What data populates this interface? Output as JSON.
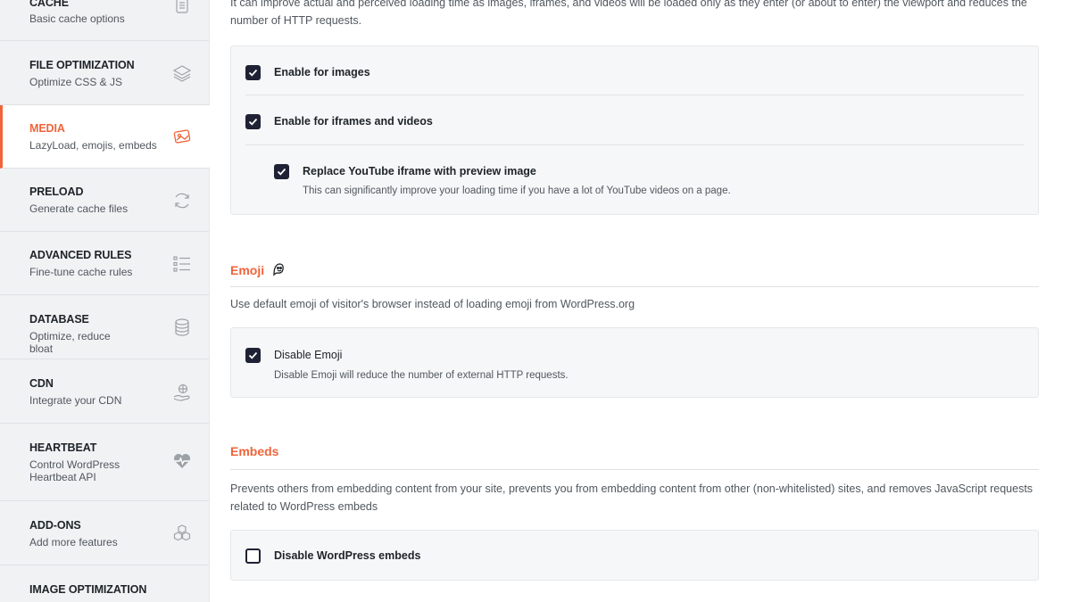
{
  "sidebar": {
    "items": [
      {
        "title": "CACHE",
        "desc": "Basic cache options",
        "icon": "document-icon"
      },
      {
        "title": "FILE OPTIMIZATION",
        "desc": "Optimize CSS & JS",
        "icon": "layers-icon"
      },
      {
        "title": "MEDIA",
        "desc": "LazyLoad, emojis, embeds",
        "icon": "media-icon",
        "active": true
      },
      {
        "title": "PRELOAD",
        "desc": "Generate cache files",
        "icon": "refresh-icon"
      },
      {
        "title": "ADVANCED RULES",
        "desc": "Fine-tune cache rules",
        "icon": "list-icon"
      },
      {
        "title": "DATABASE",
        "desc": "Optimize, reduce bloat",
        "icon": "database-icon"
      },
      {
        "title": "CDN",
        "desc": "Integrate your CDN",
        "icon": "cdn-hand-icon"
      },
      {
        "title": "HEARTBEAT",
        "desc": "Control WordPress Heartbeat API",
        "icon": "heartbeat-icon"
      },
      {
        "title": "ADD-ONS",
        "desc": "Add more features",
        "icon": "cubes-icon"
      },
      {
        "title": "IMAGE OPTIMIZATION",
        "desc": "",
        "icon": ""
      }
    ]
  },
  "lazyload": {
    "lead": "It can improve actual and perceived loading time as images, iframes, and videos will be loaded only as they enter (or about to enter) the viewport and reduces the number of HTTP requests.",
    "opt_images": "Enable for images",
    "opt_iframes": "Enable for iframes and videos",
    "opt_youtube": "Replace YouTube iframe with preview image",
    "opt_youtube_desc": "This can significantly improve your loading time if you have a lot of YouTube videos on a page."
  },
  "emoji": {
    "title": "Emoji",
    "lead": "Use default emoji of visitor's browser instead of loading emoji from WordPress.org",
    "opt_disable": "Disable Emoji",
    "opt_disable_desc": "Disable Emoji will reduce the number of external HTTP requests."
  },
  "embeds": {
    "title": "Embeds",
    "lead": "Prevents others from embedding content from your site, prevents you from embedding content from other (non-whitelisted) sites, and removes JavaScript requests related to WordPress embeds",
    "opt_disable": "Disable WordPress embeds"
  },
  "colors": {
    "accent": "#f0643a",
    "checkbox": "#1f2134",
    "sidebar_bg": "#f1f2f4"
  }
}
